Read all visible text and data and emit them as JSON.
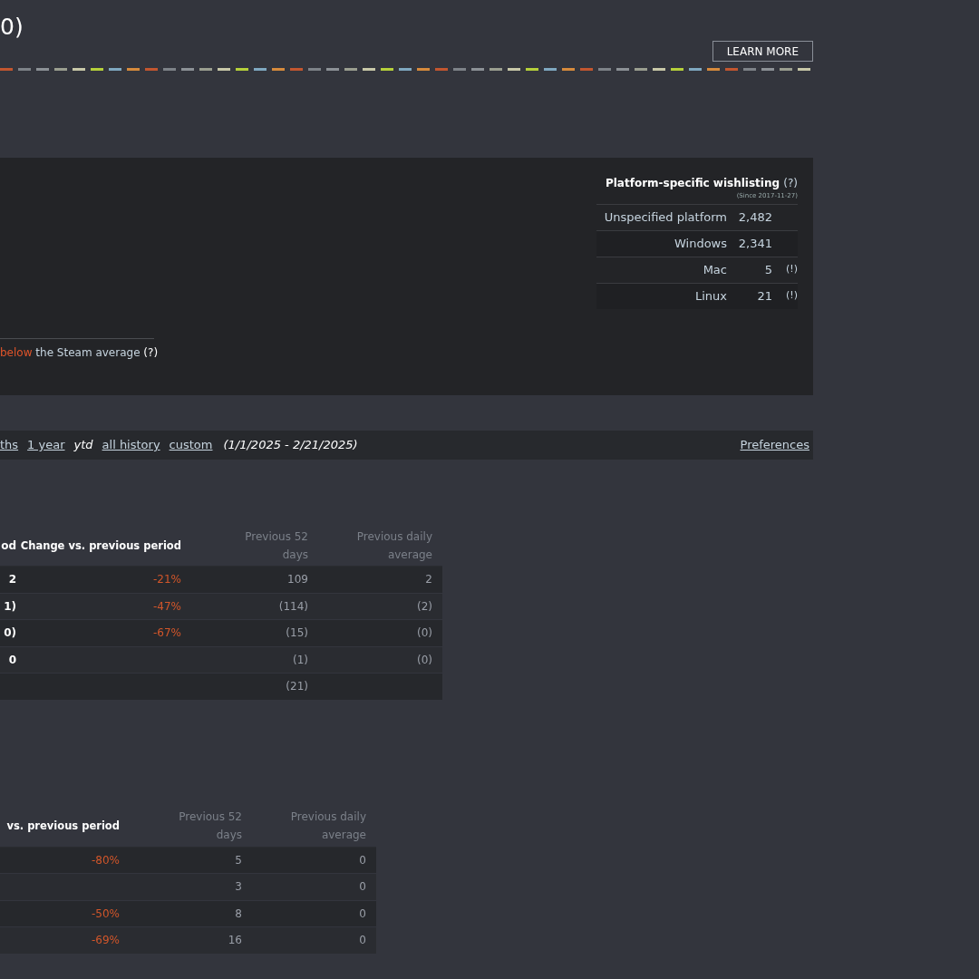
{
  "header": {
    "title": "0)",
    "learn_more": "LEARN MORE"
  },
  "summary_panel": {
    "comparison": {
      "highlight": "below",
      "rest": "the Steam average",
      "help": "(?)"
    },
    "platform_wishlisting": {
      "title": "Platform-specific wishlisting",
      "help": "(?)",
      "since": "(Since 2017-11-27)",
      "rows": [
        {
          "platform": "Unspecified platform",
          "count": "2,482"
        },
        {
          "platform": "Windows",
          "count": "2,341"
        },
        {
          "platform": "Mac",
          "count": "5",
          "note": "(!)"
        },
        {
          "platform": "Linux",
          "count": "21",
          "note": "(!)"
        }
      ]
    }
  },
  "date_range": {
    "options": [
      {
        "label": "ths",
        "selected": false
      },
      {
        "label": "1 year",
        "selected": false
      },
      {
        "label": "ytd",
        "selected": true
      },
      {
        "label": "all history",
        "selected": false
      },
      {
        "label": "custom",
        "selected": false
      }
    ],
    "range": "(1/1/2025 - 2/21/2025)",
    "preferences": "Preferences"
  },
  "tables": [
    {
      "columns": [
        {
          "label": "od",
          "kind": "period"
        },
        {
          "label": "Change vs. previous period",
          "kind": "change"
        },
        {
          "label": "Previous 52 days",
          "kind": "count"
        },
        {
          "label": "Previous daily average",
          "kind": "count"
        }
      ],
      "rows": [
        [
          "2",
          "-21%",
          "109",
          "2"
        ],
        [
          "1)",
          "-47%",
          "(114)",
          "(2)"
        ],
        [
          "0)",
          "-67%",
          "(15)",
          "(0)"
        ],
        [
          "0",
          null,
          "(1)",
          "(0)"
        ],
        [
          null,
          null,
          "(21)",
          null
        ]
      ]
    },
    {
      "columns": [
        {
          "label": "vs. previous period",
          "kind": "change"
        },
        {
          "label": "Previous 52 days",
          "kind": "count"
        },
        {
          "label": "Previous daily average",
          "kind": "count"
        }
      ],
      "rows": [
        [
          "-80%",
          "5",
          "0"
        ],
        [
          null,
          "3",
          "0"
        ],
        [
          "-50%",
          "8",
          "0"
        ],
        [
          "-69%",
          "16",
          "0"
        ]
      ]
    }
  ]
}
